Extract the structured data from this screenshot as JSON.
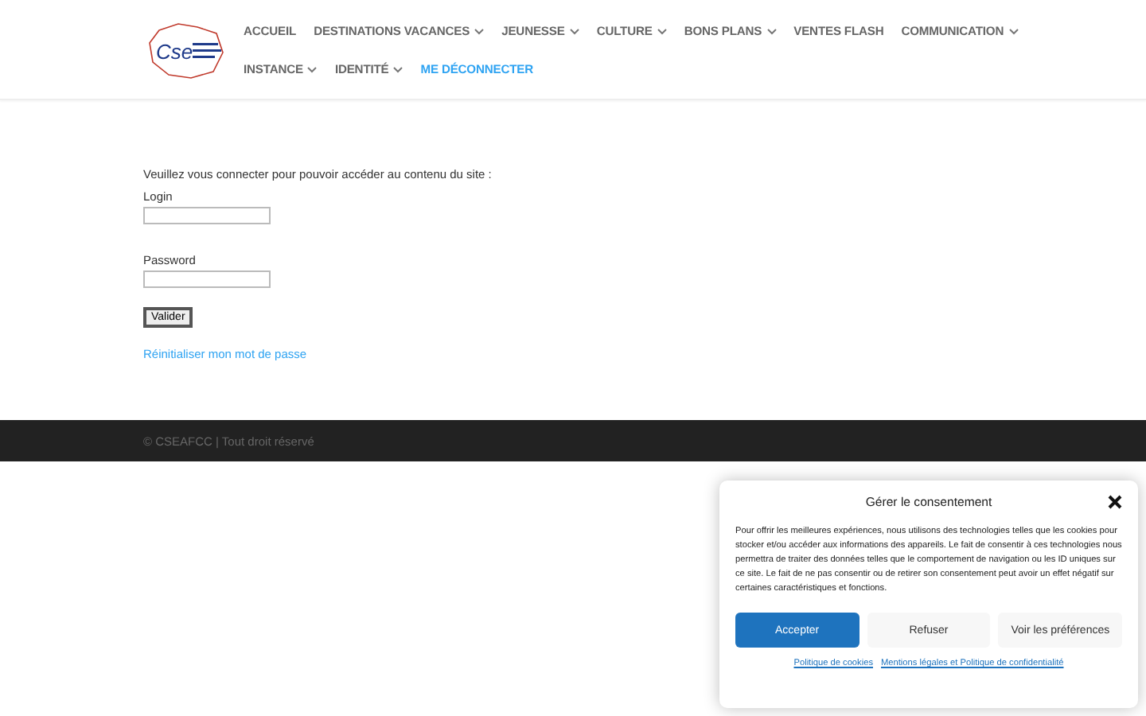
{
  "header": {
    "logo": {
      "text": "Cse"
    },
    "nav_rows": [
      [
        {
          "label": "ACCUEIL",
          "submenu": false,
          "selected": false
        },
        {
          "label": "DESTINATIONS VACANCES",
          "submenu": true,
          "selected": false
        },
        {
          "label": "JEUNESSE",
          "submenu": true,
          "selected": false
        },
        {
          "label": "CULTURE",
          "submenu": true,
          "selected": false
        },
        {
          "label": "BONS PLANS",
          "submenu": true,
          "selected": false
        },
        {
          "label": "VENTES FLASH",
          "submenu": false,
          "selected": false
        },
        {
          "label": "COMMUNICATION",
          "submenu": true,
          "selected": false
        }
      ],
      [
        {
          "label": "INSTANCE",
          "submenu": true,
          "selected": false
        },
        {
          "label": "IDENTITÉ",
          "submenu": true,
          "selected": false
        },
        {
          "label": "ME DÉCONNECTER",
          "submenu": false,
          "selected": true
        }
      ]
    ]
  },
  "login": {
    "intro": "Veuillez vous connecter pour pouvoir accéder au contenu du site :",
    "fields": [
      {
        "label": "Login"
      },
      {
        "label": "Password"
      }
    ],
    "submit": "Valider",
    "reset_link": "Réinitialiser mon mot de passe"
  },
  "footer": {
    "text": "© CSEAFCC | Tout droit réservé"
  },
  "cookie_banner": {
    "title": "Gérer le consentement",
    "message": "Pour offrir les meilleures expériences, nous utilisons des technologies telles que les cookies pour stocker et/ou accéder aux informations des appareils. Le fait de consentir à ces technologies nous permettra de traiter des données telles que le comportement de navigation ou les ID uniques sur ce site. Le fait de ne pas consentir ou de retirer son consentement peut avoir un effet négatif sur certaines caractéristiques et fonctions.",
    "buttons": [
      {
        "label": "Accepter",
        "kind": "primary"
      },
      {
        "label": "Refuser",
        "kind": "secondary"
      },
      {
        "label": "Voir les préférences",
        "kind": "secondary"
      }
    ],
    "links": [
      "Politique de cookies",
      "Mentions légales et Politique de confidentialité"
    ]
  }
}
